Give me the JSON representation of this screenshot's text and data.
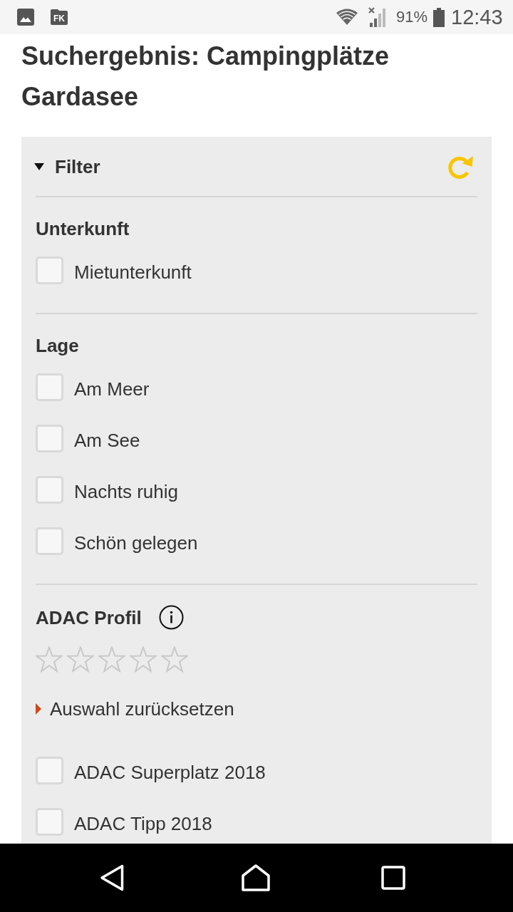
{
  "status_bar": {
    "app_icon_label": "FK",
    "battery": "91%",
    "time": "12:43"
  },
  "title": "Suchergebnis: Campingplätze Gardasee",
  "filter": {
    "title": "Filter",
    "expanded": true,
    "sections": [
      {
        "heading": "Unterkunft",
        "options": [
          {
            "label": "Mietunterkunft",
            "checked": false
          }
        ]
      },
      {
        "heading": "Lage",
        "options": [
          {
            "label": "Am Meer",
            "checked": false
          },
          {
            "label": "Am See",
            "checked": false
          },
          {
            "label": "Nachts ruhig",
            "checked": false
          },
          {
            "label": "Schön gelegen",
            "checked": false
          }
        ]
      },
      {
        "heading": "ADAC Profil",
        "info": true,
        "stars": 0,
        "reset_link": "Auswahl zurücksetzen",
        "options": [
          {
            "label": "ADAC Superplatz 2018",
            "checked": false
          },
          {
            "label": "ADAC Tipp 2018",
            "checked": false
          }
        ]
      }
    ]
  }
}
